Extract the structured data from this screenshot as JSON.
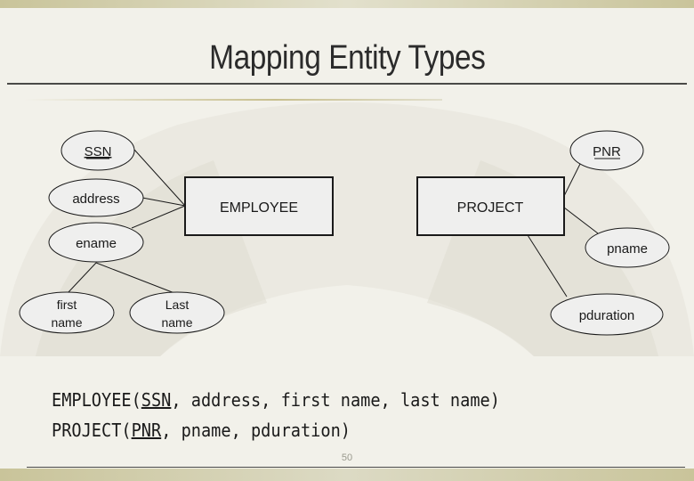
{
  "slide": {
    "title": "Mapping Entity Types",
    "page_number": "50",
    "colors": {
      "background": "#f2f1ea",
      "accent_bar": "#c9c49a",
      "text": "#1a1a1a"
    }
  },
  "diagram": {
    "entities": [
      {
        "id": "employee",
        "label": "EMPLOYEE"
      },
      {
        "id": "project",
        "label": "PROJECT"
      }
    ],
    "attributes": [
      {
        "id": "ssn",
        "label": "SSN",
        "key": true,
        "entity": "employee"
      },
      {
        "id": "address",
        "label": "address",
        "key": false,
        "entity": "employee"
      },
      {
        "id": "ename",
        "label": "ename",
        "key": false,
        "entity": "employee",
        "composite": true
      },
      {
        "id": "first-name",
        "label_lines": [
          "first",
          "name"
        ],
        "key": false,
        "parent": "ename"
      },
      {
        "id": "last-name",
        "label_lines": [
          "Last",
          "name"
        ],
        "key": false,
        "parent": "ename"
      },
      {
        "id": "pnr",
        "label": "PNR",
        "key": true,
        "entity": "project"
      },
      {
        "id": "pname",
        "label": "pname",
        "key": false,
        "entity": "project"
      },
      {
        "id": "pduration",
        "label": "pduration",
        "key": false,
        "entity": "project"
      }
    ]
  },
  "relations": [
    {
      "name": "EMPLOYEE",
      "key": "SSN",
      "rest": ", address, first name, last name)"
    },
    {
      "name": "PROJECT",
      "key": "PNR",
      "rest": ", pname, pduration)"
    }
  ]
}
